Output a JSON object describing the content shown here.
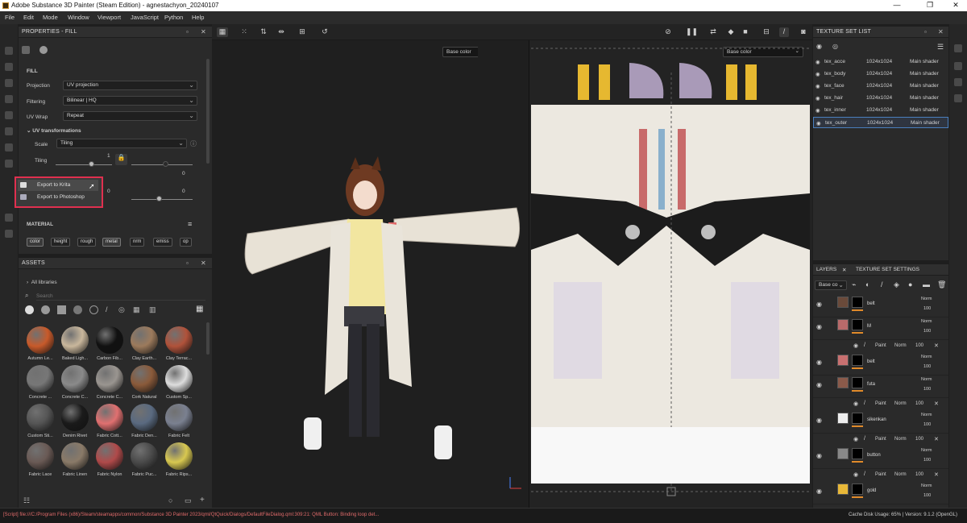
{
  "window": {
    "title": "Adobe Substance 3D Painter (Steam Edition) - agnestachyon_20240107",
    "controls": [
      "—",
      "❐",
      "✕"
    ]
  },
  "menu": [
    "File",
    "Edit",
    "Mode",
    "Window",
    "Viewport",
    "JavaScript",
    "Python",
    "Help"
  ],
  "properties": {
    "title": "PROPERTIES - FILL",
    "section": "FILL",
    "projection_label": "Projection",
    "projection_value": "UV projection",
    "filtering_label": "Filtering",
    "filtering_value": "Bilinear | HQ",
    "uvwrap_label": "UV Wrap",
    "uvwrap_value": "Repeat",
    "uvtrans_label": "UV transformations",
    "scale_label": "Scale",
    "scale_value": "Tiling",
    "tiling_label": "Tiling",
    "tiling_value": "1",
    "val_zero_a": "0",
    "val_zero_b": "0",
    "val_zero_c": "0",
    "val_zero_d": "0",
    "material_label": "MATERIAL",
    "channels": [
      "color",
      "height",
      "rough",
      "metal",
      "nrm",
      "emiss",
      "op"
    ]
  },
  "popup": {
    "items": [
      "Export to Krita",
      "Export to Photoshop"
    ]
  },
  "assets": {
    "title": "ASSETS",
    "library": "All libraries",
    "search_placeholder": "Search",
    "materials": [
      "Autumn Le...",
      "Baked Ligh...",
      "Carbon Fib...",
      "Clay Earth...",
      "Clay Terrac...",
      "Concrete ...",
      "Concrete C...",
      "Concrete C...",
      "Cork Natural",
      "Custom Sp...",
      "Custom Sti...",
      "Denim Rivet",
      "Fabric Cott...",
      "Fabric Den...",
      "Fabric Felt",
      "Fabric Lace",
      "Fabric Linen",
      "Fabric Nylon",
      "Fabric Puc...",
      "Fabric Rips..."
    ],
    "material_colors": [
      "#c85a2a",
      "#c9b79c",
      "#111111",
      "#9c7a5c",
      "#b0523a",
      "#777777",
      "#8a8a8a",
      "#9a9590",
      "#8a5a3a",
      "#dddddd",
      "#555555",
      "#1a1a1a",
      "#e07070",
      "#5a6a80",
      "#7a8090",
      "#6a5a55",
      "#8a7a68",
      "#b04a4a",
      "#4a4a4a",
      "#d8c850"
    ]
  },
  "viewport": {
    "left_channel": "Base color",
    "right_channel": "Base color"
  },
  "texture_set_list": {
    "title": "TEXTURE SET LIST",
    "rows": [
      {
        "name": "tex_acce",
        "res": "1024x1024",
        "shader": "Main shader"
      },
      {
        "name": "tex_body",
        "res": "1024x1024",
        "shader": "Main shader"
      },
      {
        "name": "tex_face",
        "res": "1024x1024",
        "shader": "Main shader"
      },
      {
        "name": "tex_hair",
        "res": "1024x1024",
        "shader": "Main shader"
      },
      {
        "name": "tex_inner",
        "res": "1024x1024",
        "shader": "Main shader"
      },
      {
        "name": "tex_outer",
        "res": "1024x1024",
        "shader": "Main shader"
      }
    ]
  },
  "layers": {
    "tab_layers": "LAYERS",
    "tab_tss": "TEXTURE SET SETTINGS",
    "channel": "Base co",
    "paint_label": "Paint",
    "blend": "Norm",
    "opacity": "100",
    "items": [
      {
        "name": "belt",
        "color": "#6a4a3a"
      },
      {
        "name": "M",
        "color": "#b86a6a"
      },
      {
        "name": "belt",
        "color": "#c87070"
      },
      {
        "name": "futa",
        "color": "#8a5a4a"
      },
      {
        "name": "sikenkan",
        "color": "#eeeeee"
      },
      {
        "name": "button",
        "color": "#888888"
      },
      {
        "name": "gold",
        "color": "#e8b838"
      }
    ]
  },
  "status": {
    "log": "[Script] file:///C:/Program Files (x86)/Steam/steamapps/common/Substance 3D Painter 2023/qml/QtQuick/Dialogs/DefaultFileDialog.qml:309:21: QML Button: Binding loop det...",
    "right": "Cache Disk Usage:   65% | Version: 9.1.2 (OpenGL)"
  }
}
